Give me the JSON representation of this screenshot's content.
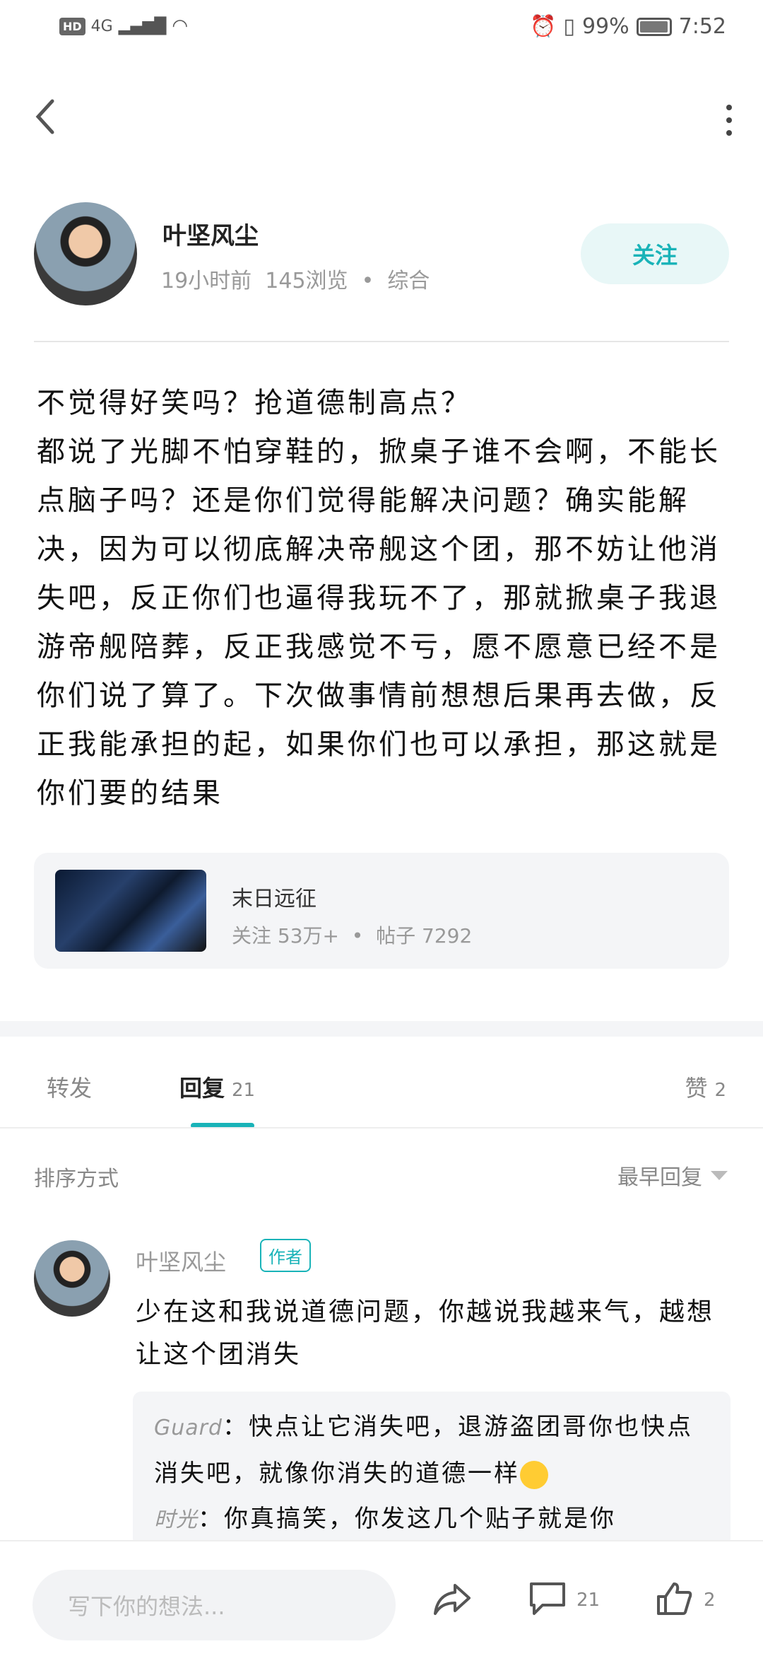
{
  "status_bar": {
    "hd": "HD",
    "network": "4G",
    "battery": "99%",
    "time": "7:52"
  },
  "author": {
    "name": "叶坚风尘",
    "time": "19小时前",
    "views": "145浏览",
    "category": "综合",
    "follow_label": "关注"
  },
  "post": {
    "lines": [
      "不觉得好笑吗？抢道德制高点？",
      "都说了光脚不怕穿鞋的，掀桌子谁不会啊，不能长点脑子吗？还是你们觉得能解决问题？确实能解决，因为可以彻底解决帝舰这个团，那不妨让他消失吧，反正你们也逼得我玩不了，那就掀桌子我退游帝舰陪葬，反正我感觉不亏，愿不愿意已经不是你们说了算了。下次做事情前想想后果再去做，反正我能承担的起，如果你们也可以承担，那这就是你们要的结果"
    ]
  },
  "game": {
    "name": "末日远征",
    "followers": "关注 53万+",
    "posts": "帖子 7292"
  },
  "tabs": [
    {
      "label": "转发",
      "count": ""
    },
    {
      "label": "回复",
      "count": "21"
    },
    {
      "label": "赞",
      "count": "2"
    }
  ],
  "sort": {
    "label": "排序方式",
    "value": "最早回复"
  },
  "reply": {
    "name": "叶坚风尘",
    "badge": "作者",
    "text": "少在这和我说道德问题，你越说我越来气，越想让这个团消失",
    "quote": {
      "user1": "Guard",
      "text1": "：快点让它消失吧，退游盗团哥你也快点消失吧，就像你消失的道德一样",
      "user2": "时光",
      "text2": "：你真搞笑，你发这几个贴子就是你"
    }
  },
  "bottom": {
    "placeholder": "写下你的想法...",
    "comments": "21",
    "likes": "2"
  },
  "colors": {
    "accent": "#19b3b8",
    "follow_bg": "#e8f7f7",
    "card_bg": "#f4f5f7"
  }
}
